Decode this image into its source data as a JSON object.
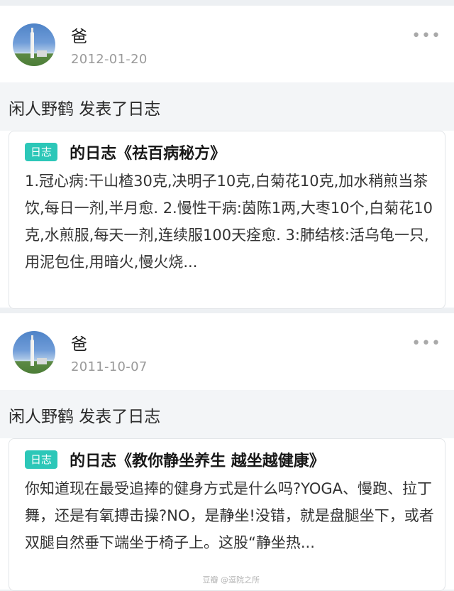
{
  "posts": [
    {
      "author": "爸",
      "date": "2012-01-20",
      "more_icon": "more-dots-icon",
      "action": "闲人野鹤 发表了日志",
      "card": {
        "tag": "日志",
        "title": "的日志《祛百病秘方》",
        "excerpt": "1.冠心病:干山楂30克,决明子10克,白菊花10克,加水稍煎当茶饮,每日一剂,半月愈. 2.慢性干病:茵陈1两,大枣10个,白菊花10克,水煎服,每天一剂,连续服100天痊愈.  3:肺结核:活乌龟一只,用泥包住,用暗火,慢火烧..."
      }
    },
    {
      "author": "爸",
      "date": "2011-10-07",
      "more_icon": "more-dots-icon",
      "action": "闲人野鹤 发表了日志",
      "card": {
        "tag": "日志",
        "title": "的日志《教你静坐养生 越坐越健康》",
        "excerpt": "你知道现在最受追捧的健身方式是什么吗?YOGA、慢跑、拉丁舞，还是有氧搏击操?NO，是静坐!没错，就是盘腿坐下，或者双腿自然垂下端坐于椅子上。这股“静坐热..."
      }
    }
  ],
  "watermark": "豆瓣 @逗院之所"
}
